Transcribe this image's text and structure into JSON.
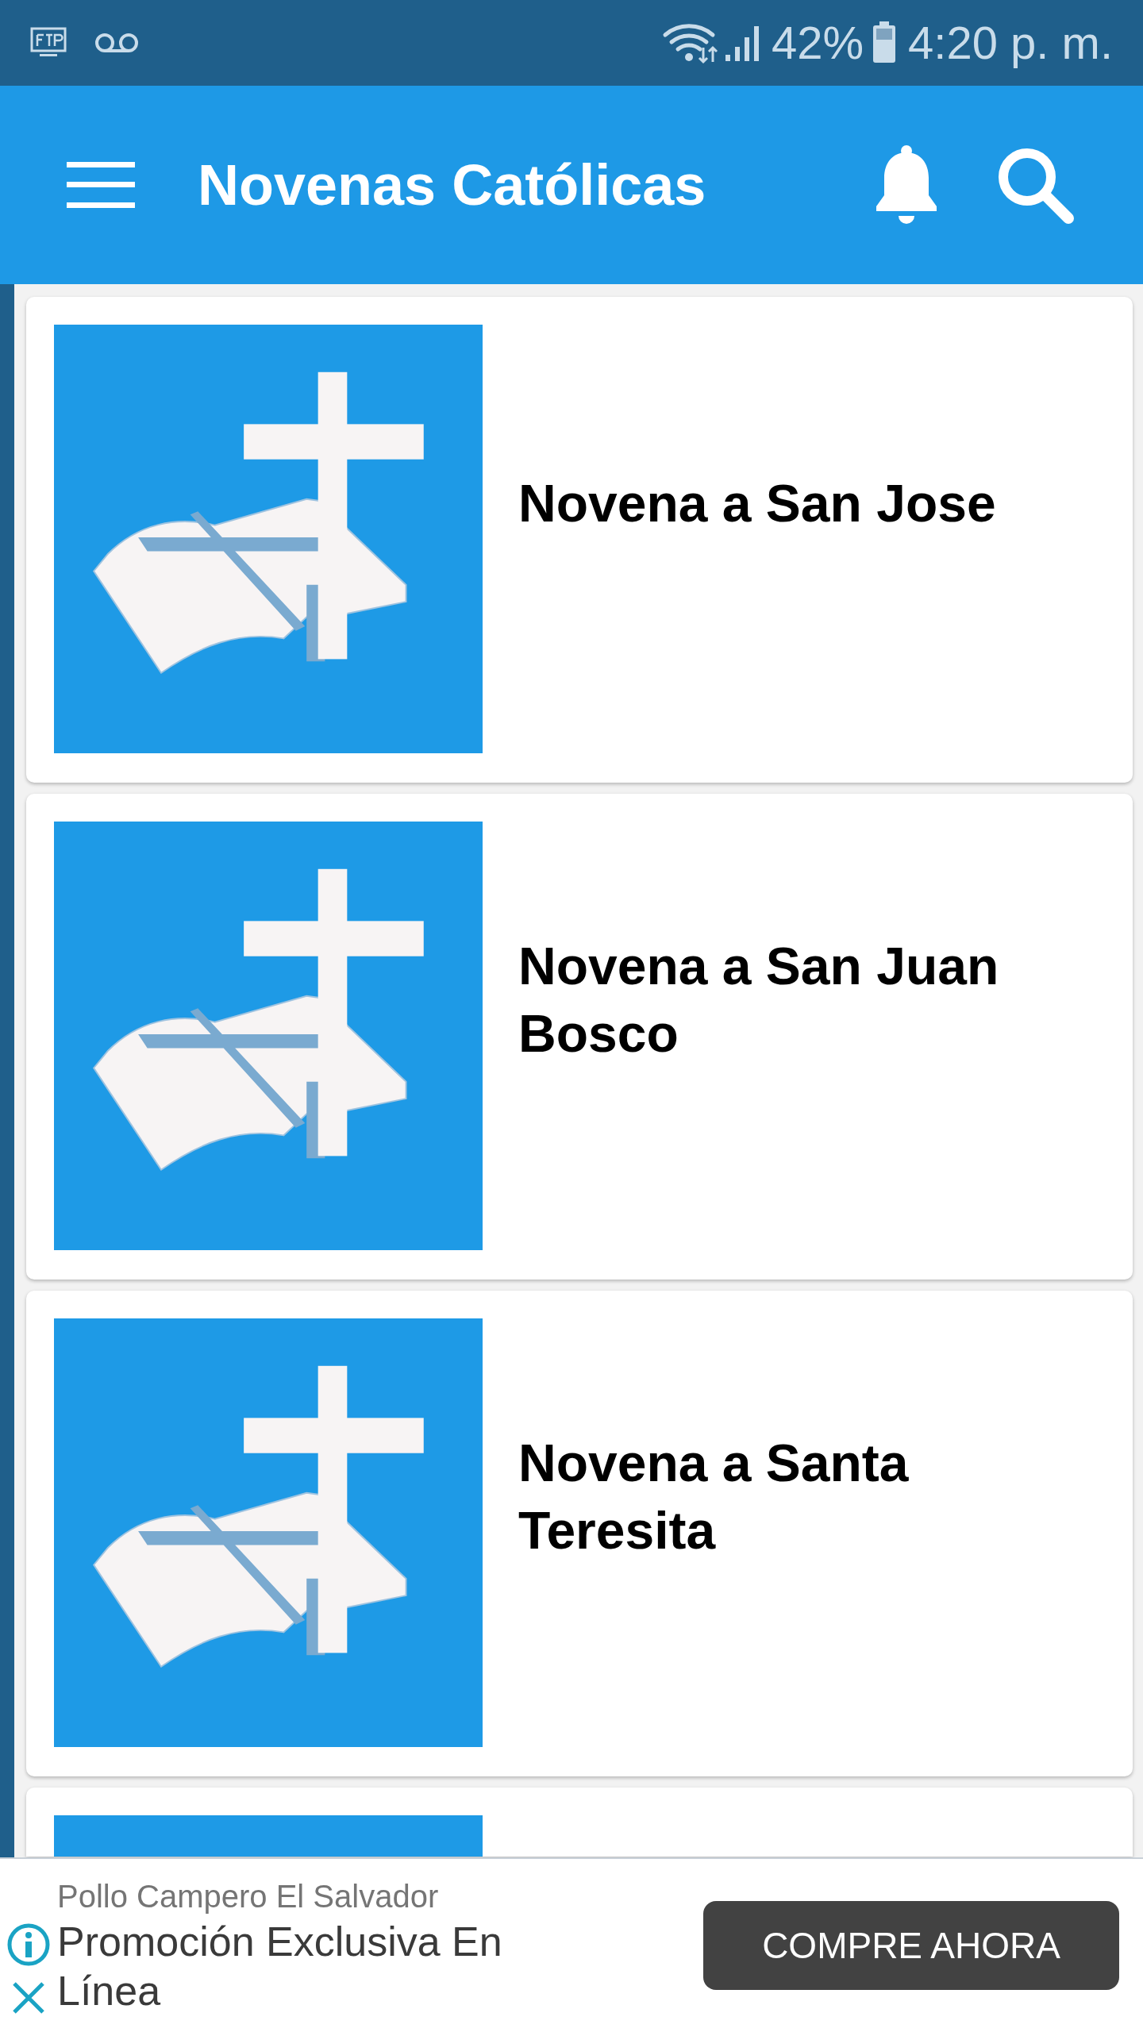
{
  "status_bar": {
    "battery": "42%",
    "time": "4:20 p. m."
  },
  "app_bar": {
    "title": "Novenas Católicas"
  },
  "novenas": [
    {
      "title": "Novena a San Jose"
    },
    {
      "title": "Novena a San Juan Bosco"
    },
    {
      "title": "Novena a Santa Teresita"
    }
  ],
  "next_card_peek": true,
  "ad": {
    "advertiser": "Pollo Campero El Salvador",
    "headline": "Promoción Exclusiva En Línea",
    "button": "COMPRE AHORA"
  }
}
